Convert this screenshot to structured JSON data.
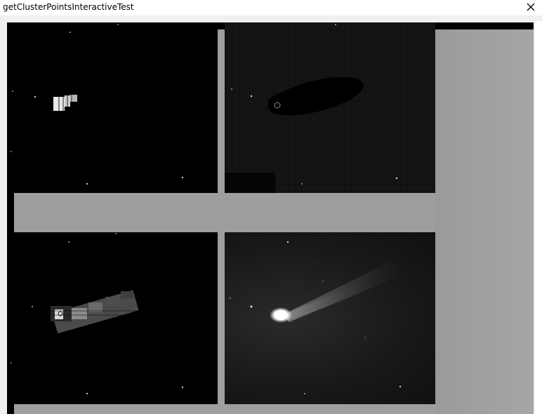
{
  "window": {
    "title": "getClusterPointsInteractiveTest",
    "close_icon": "close-icon"
  },
  "panels": [
    {
      "name": "cluster-mask-panel"
    },
    {
      "name": "inverted-cluster-panel"
    },
    {
      "name": "cluster-points-panel"
    },
    {
      "name": "original-comet-image-panel"
    }
  ],
  "colors": {
    "titlebar": "#ffffff",
    "frame_gray": "#9e9e9e",
    "canvas_black": "#000000"
  }
}
